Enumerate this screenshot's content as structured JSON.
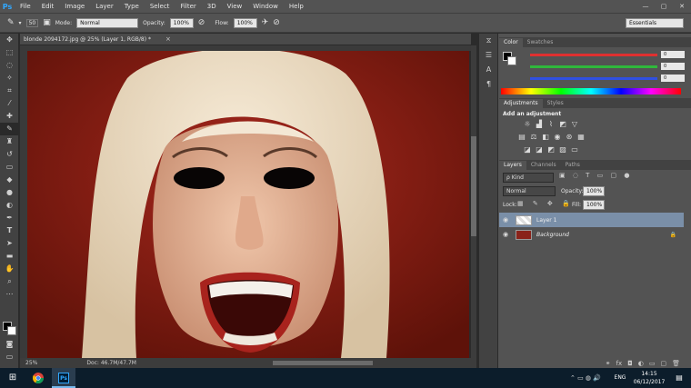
{
  "app": {
    "logo": "Ps"
  },
  "menu": [
    "File",
    "Edit",
    "Image",
    "Layer",
    "Type",
    "Select",
    "Filter",
    "3D",
    "View",
    "Window",
    "Help"
  ],
  "window_controls": [
    "—",
    "▢",
    "✕"
  ],
  "options": {
    "brush_size": "50",
    "mode_label": "Mode:",
    "mode_value": "Normal",
    "opacity_label": "Opacity:",
    "opacity_value": "100%",
    "flow_label": "Flow:",
    "flow_value": "100%",
    "workspace": "Essentials"
  },
  "document": {
    "tab_title": "blonde 2094172.jpg @ 25% (Layer 1, RGB/8) *",
    "close": "×",
    "zoom": "25%",
    "doc_size": "Doc: 46.7M/47.7M"
  },
  "color_panel": {
    "tabs": [
      "Color",
      "Swatches"
    ],
    "values": [
      "0",
      "0",
      "0"
    ],
    "slider_colors": [
      "#e03030",
      "#2fb83c",
      "#3050e0"
    ]
  },
  "adjustments_panel": {
    "tabs": [
      "Adjustments",
      "Styles"
    ],
    "heading": "Add an adjustment"
  },
  "layers_panel": {
    "tabs": [
      "Layers",
      "Channels",
      "Paths"
    ],
    "filter_label": "ρ Kind",
    "blend_mode": "Normal",
    "opacity_label": "Opacity:",
    "opacity_value": "100%",
    "lock_label": "Lock:",
    "fill_label": "Fill:",
    "fill_value": "100%",
    "layers": [
      {
        "name": "Layer 1",
        "selected": true
      },
      {
        "name": "Background",
        "selected": false
      }
    ]
  },
  "taskbar": {
    "language": "ENG",
    "time": "14:15",
    "date": "06/12/2017"
  }
}
